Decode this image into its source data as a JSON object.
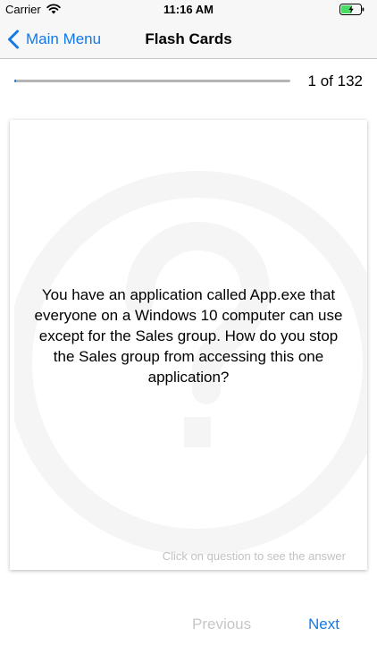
{
  "status_bar": {
    "carrier": "Carrier",
    "time": "11:16 AM",
    "battery_icon": "battery-charging-icon",
    "wifi_icon": "wifi-icon"
  },
  "nav": {
    "back_label": "Main Menu",
    "title": "Flash Cards"
  },
  "progress": {
    "label": "1 of 132",
    "current": 1,
    "total": 132
  },
  "card": {
    "question": "You have an application called App.exe that everyone on a Windows 10 computer can use except for the Sales group. How do you stop the Sales group from accessing this one application?",
    "hint": "Click on question to see the answer"
  },
  "buttons": {
    "previous_label": "Previous",
    "next_label": "Next"
  },
  "colors": {
    "accent": "#1479e6",
    "disabled": "#c6c6c6",
    "bar_bg": "#f7f7f7"
  }
}
